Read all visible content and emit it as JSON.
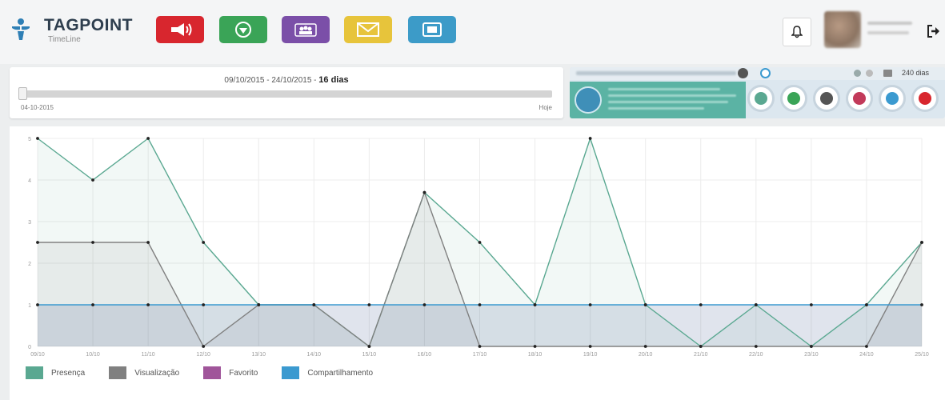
{
  "app": {
    "brand": "TAGPOINT",
    "brand_sub": "TimeLine"
  },
  "toolbar": {
    "buttons": [
      {
        "icon": "megaphone-icon",
        "color": "#d8262e"
      },
      {
        "icon": "gem-icon",
        "color": "#3aa457"
      },
      {
        "icon": "people-icon",
        "color": "#7b4fa8"
      },
      {
        "icon": "envelope-icon",
        "color": "#e7c43b"
      },
      {
        "icon": "folder-icon",
        "color": "#3c9bc8"
      }
    ]
  },
  "date_panel": {
    "range_text": "09/10/2015 - 24/10/2015 - ",
    "days_text": "16 dias",
    "start_label": "04-10-2015",
    "end_label": "Hoje"
  },
  "right_panel": {
    "days_label": "240 dias"
  },
  "chart_data": {
    "type": "area",
    "x": [
      "09/10",
      "10/10",
      "11/10",
      "12/10",
      "13/10",
      "14/10",
      "15/10",
      "16/10",
      "17/10",
      "18/10",
      "19/10",
      "20/10",
      "21/10",
      "22/10",
      "23/10",
      "24/10",
      "25/10"
    ],
    "ylim": [
      0,
      5
    ],
    "yticks": [
      "0",
      "1",
      "2",
      "3",
      "4",
      "5"
    ],
    "series": [
      {
        "name": "Presença",
        "color": "#5aa891",
        "values": [
          5,
          4,
          5,
          2.5,
          1,
          1,
          0,
          3.7,
          2.5,
          1,
          5,
          1,
          0,
          1,
          0,
          1,
          2.5
        ]
      },
      {
        "name": "Visualização",
        "color": "#808080",
        "values": [
          2.5,
          2.5,
          2.5,
          0,
          1,
          1,
          0,
          3.7,
          0,
          0,
          0,
          0,
          0,
          0,
          0,
          0,
          2.5
        ]
      },
      {
        "name": "Favorito",
        "color": "#a0559a",
        "values": []
      },
      {
        "name": "Compartilhamento",
        "color": "#3b9ad0",
        "values": [
          1,
          1,
          1,
          1,
          1,
          1,
          1,
          1,
          1,
          1,
          1,
          1,
          1,
          1,
          1,
          1,
          1
        ]
      }
    ]
  }
}
